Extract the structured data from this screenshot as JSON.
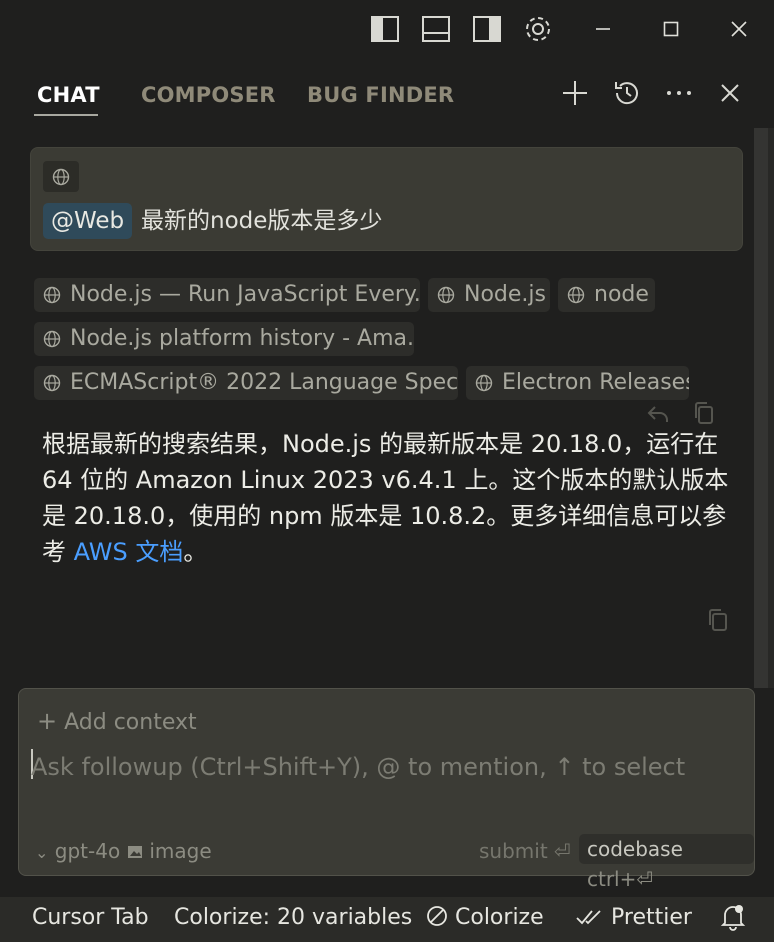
{
  "window": {
    "controls": [
      "toggle-primary-sidebar-icon",
      "toggle-panel-icon",
      "toggle-secondary-sidebar-icon",
      "gear-icon",
      "minimize-icon",
      "maximize-icon",
      "close-icon"
    ]
  },
  "tabs": [
    {
      "label": "CHAT",
      "active": true
    },
    {
      "label": "COMPOSER",
      "active": false
    },
    {
      "label": "BUG FINDER",
      "active": false
    }
  ],
  "query": {
    "mention": "@Web",
    "text": "最新的node版本是多少"
  },
  "sources": [
    "Node.js — Run JavaScript Every...",
    "Node.js",
    "node",
    "Node.js platform history - Ama...",
    "ECMAScript® 2022 Language Spec...",
    "Electron Releases"
  ],
  "answer": {
    "text": "根据最新的搜索结果，Node.js 的最新版本是 20.18.0，运行在 64 位的 Amazon Linux 2023 v6.4.1 上。这个版本的默认版本是 20.18.0，使用的 npm 版本是 10.8.2。更多详细信息可以参考 ",
    "link": "AWS 文档",
    "tail": "。"
  },
  "input": {
    "add_context": "Add context",
    "placeholder": "Ask followup (Ctrl+Shift+Y), @ to mention, ↑ to select",
    "model": "gpt-4o",
    "image": "image",
    "submit": "submit ⏎",
    "codebase": "codebase",
    "codebase_key": "ctrl+⏎"
  },
  "statusbar": {
    "cursor_tab": "Cursor Tab",
    "colorize_vars": "Colorize: 20 variables",
    "colorize": "Colorize",
    "prettier": "Prettier"
  },
  "colors": {
    "accent_link": "#4a9eff",
    "background": "#1f1f1e"
  }
}
